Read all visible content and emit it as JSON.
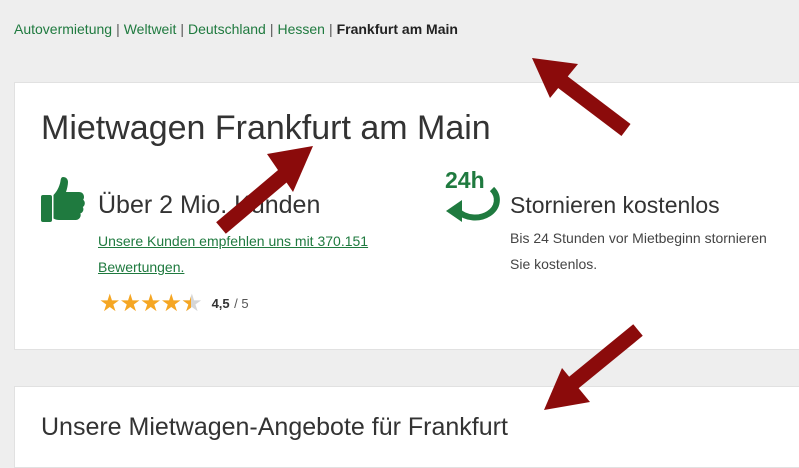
{
  "breadcrumb": {
    "items": [
      "Autovermietung",
      "Weltweit",
      "Deutschland",
      "Hessen"
    ],
    "separator": "|",
    "current": "Frankfurt am Main"
  },
  "main": {
    "title": "Mietwagen Frankfurt am Main",
    "customers": {
      "icon": "thumbs-up-icon",
      "heading": "Über 2 Mio. Kunden",
      "link_text": "Unsere Kunden empfehlen uns mit 370.151 Bewertungen.",
      "rating_value": "4,5",
      "rating_max": "/ 5",
      "stars": 4.5
    },
    "cancellation": {
      "icon": "24h-cancellation-icon",
      "icon_text": "24h",
      "heading": "Stornieren kostenlos",
      "description": "Bis 24 Stunden vor Mietbeginn stornieren Sie kostenlos."
    }
  },
  "offers": {
    "title": "Unsere Mietwagen-Angebote für Frankfurt"
  },
  "colors": {
    "accent_green": "#1f7a3f",
    "star": "#f5a623",
    "arrow": "#8b0b0b",
    "background": "#eeeeee"
  },
  "annotations": {
    "icon": "red-arrow-icon",
    "count": 3
  }
}
